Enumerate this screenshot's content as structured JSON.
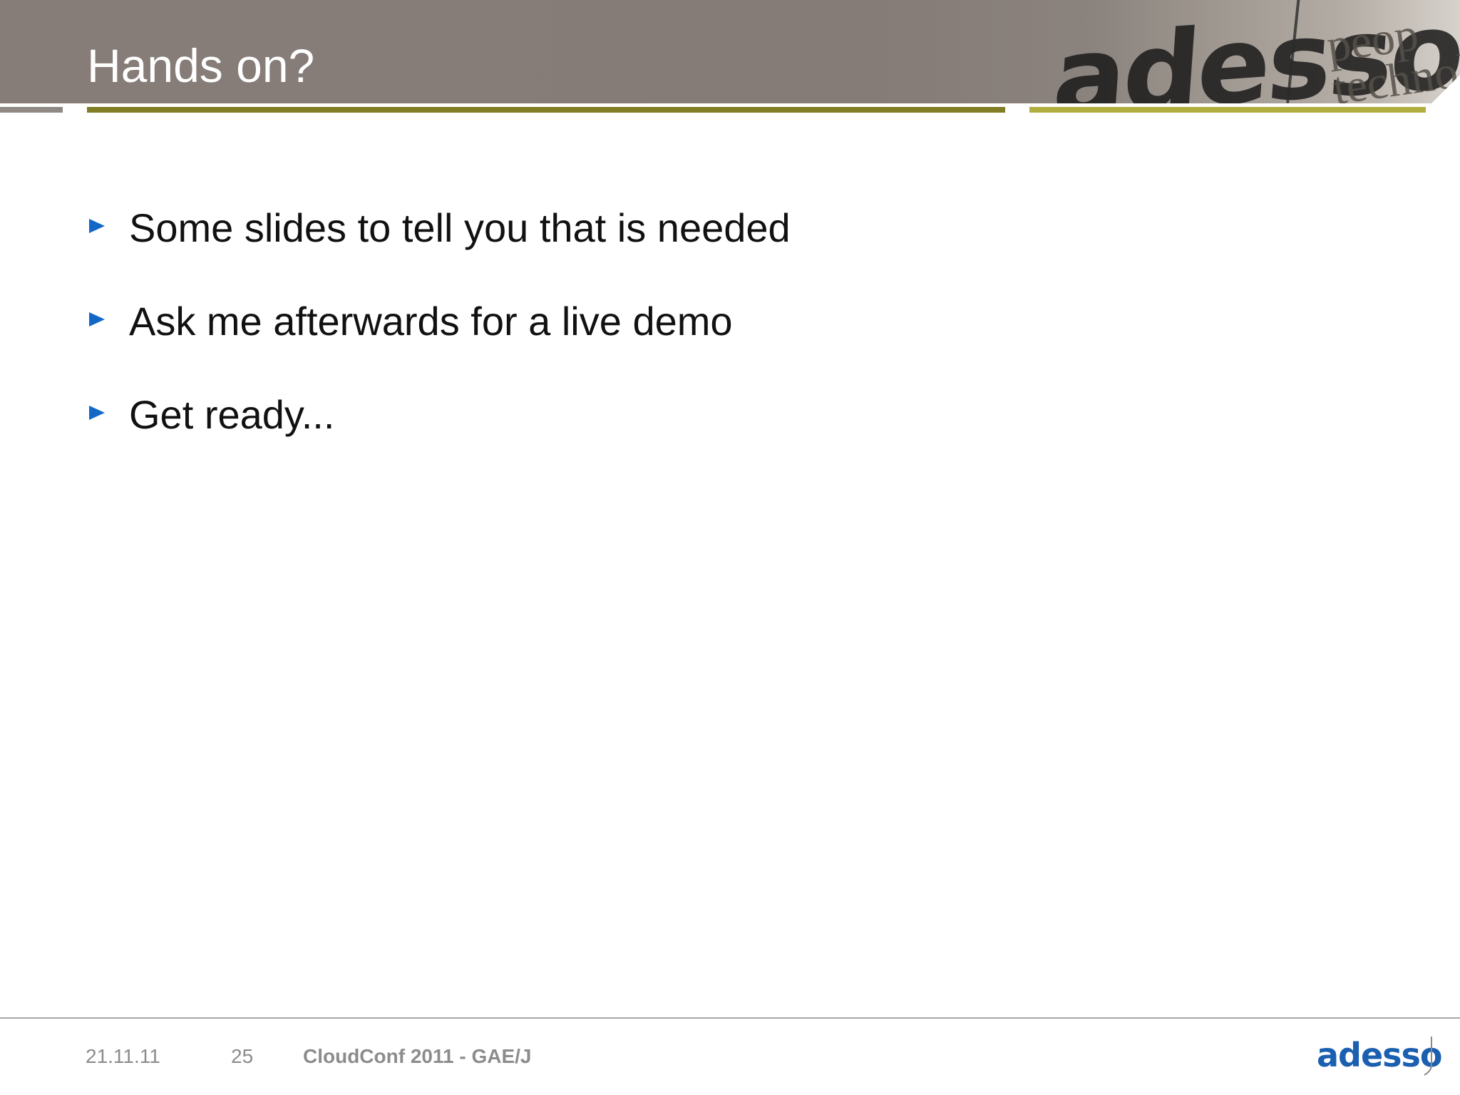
{
  "slide": {
    "title": "Hands on?",
    "bullets": [
      "Some slides to tell you that is needed",
      "Ask me afterwards for a live demo",
      "Get ready..."
    ]
  },
  "header_watermark": {
    "logo_text": "adesso",
    "tagline_line1": "peop",
    "tagline_line2": "technolo"
  },
  "footer": {
    "date": "21.11.11",
    "page": "25",
    "event": "CloudConf 2011 - GAE/J",
    "logo": "adesso"
  },
  "colors": {
    "header_bg": "#867c78",
    "rule_olive": "#807d24",
    "rule_yellow": "#b1ad3e",
    "bullet_accent": "#1368c7",
    "logo_blue": "#1a5fb0"
  }
}
